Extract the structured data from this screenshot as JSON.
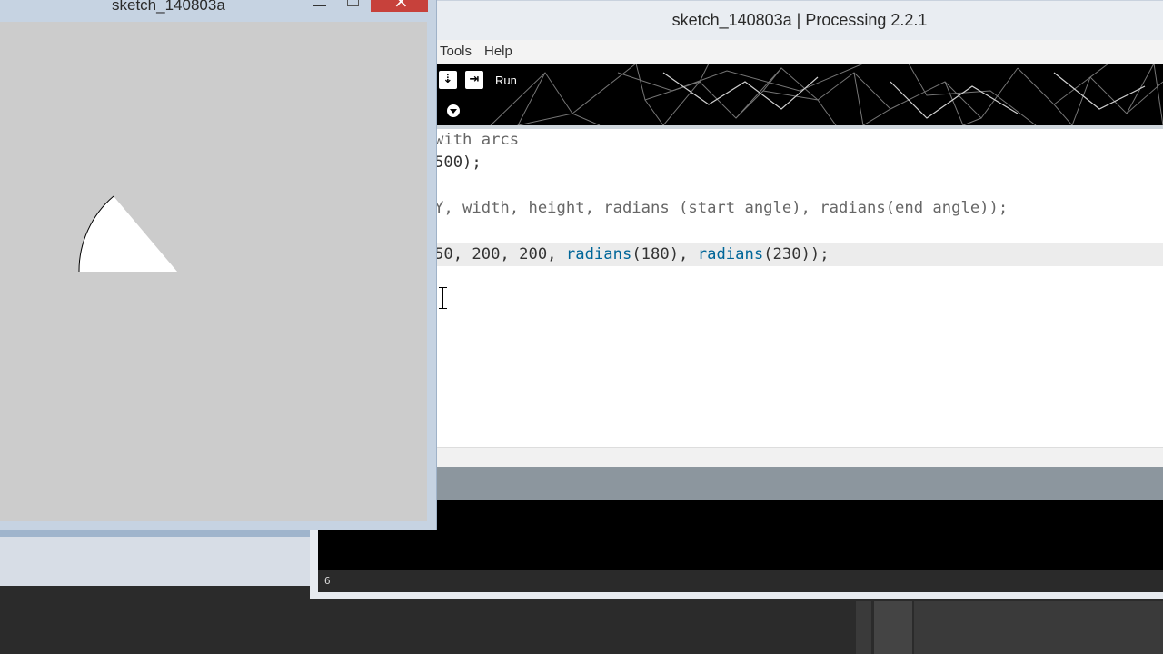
{
  "sketch_window": {
    "title": "sketch_140803a"
  },
  "ide": {
    "title": "sketch_140803a | Processing 2.2.1",
    "menu": [
      "Tools",
      "Help"
    ],
    "toolbar": {
      "run_label": "Run",
      "icons": [
        "export-icon",
        "present-icon"
      ]
    },
    "code_lines": {
      "line1": "with arcs",
      "line2": "500);",
      "line4": "Y, width, height, radians (start angle), radians(end angle));",
      "line6_prefix": "50, 200, 200, ",
      "line6_fn1": "radians",
      "line6_arg1": "(180), ",
      "line6_fn2": "radians",
      "line6_arg2": "(230));"
    },
    "status_line_number": "6"
  },
  "colors": {
    "toolbar_bg": "#000000",
    "editor_bg": "#ffffff",
    "keyword": "#006699",
    "canvas_bg": "#cccccc",
    "close_button": "#c7413b"
  }
}
